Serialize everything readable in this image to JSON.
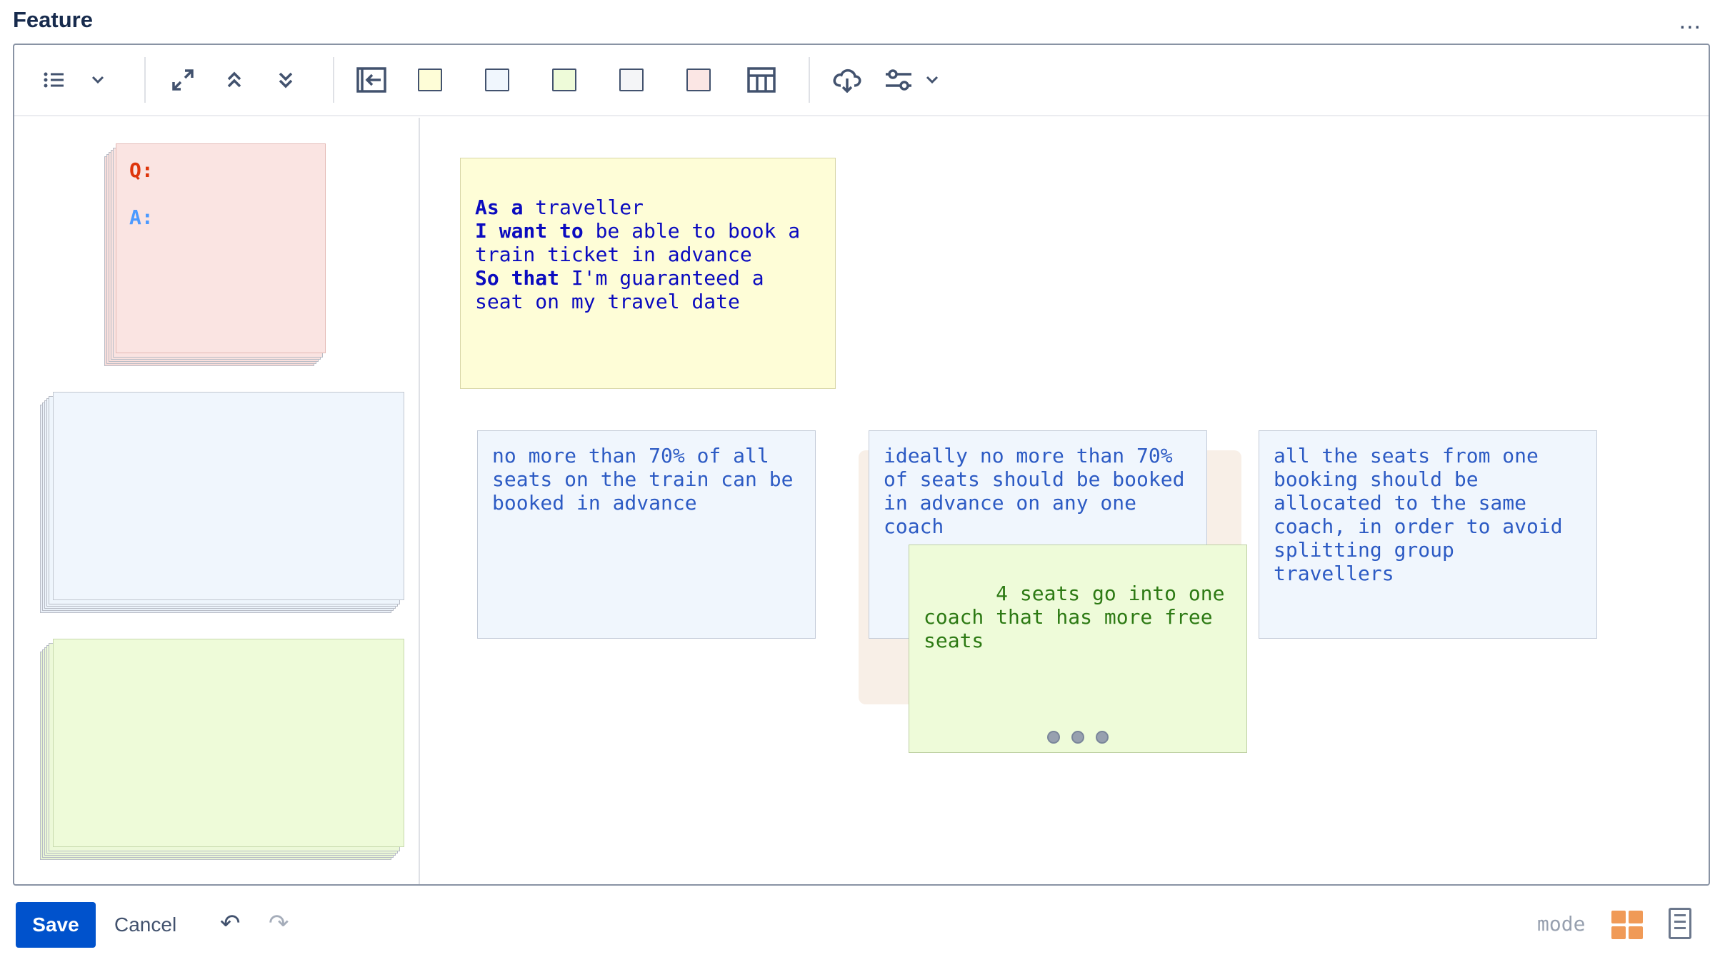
{
  "page": {
    "title": "Feature",
    "more": "..."
  },
  "toolbar": {
    "swatch_colors": [
      "#fefdd7",
      "#f0f6fd",
      "#eefbd9",
      "#f4f5f7",
      "#fbe6e4"
    ]
  },
  "sidebar": {
    "question_card": {
      "q_label": "Q:",
      "a_label": "A:"
    }
  },
  "cards": {
    "story": {
      "as_a": "As a",
      "as_a_text": " traveller",
      "i_want": "I want to",
      "i_want_text": " be able to book a train ticket in advance",
      "so_that": "So that",
      "so_that_text": " I'm guaranteed a seat on my travel date"
    },
    "rule1": "no more than 70% of all seats on the train can be booked in advance",
    "rule2": "ideally no more than 70% of seats should be booked in advance on any one coach",
    "example1": "4 seats go into one coach that has more free seats",
    "rule3": "all the seats from one booking should be allocated to the same coach, in order to avoid splitting group travellers"
  },
  "footer": {
    "save": "Save",
    "cancel": "Cancel",
    "undo": "↶",
    "redo": "↷",
    "mode": "mode"
  }
}
